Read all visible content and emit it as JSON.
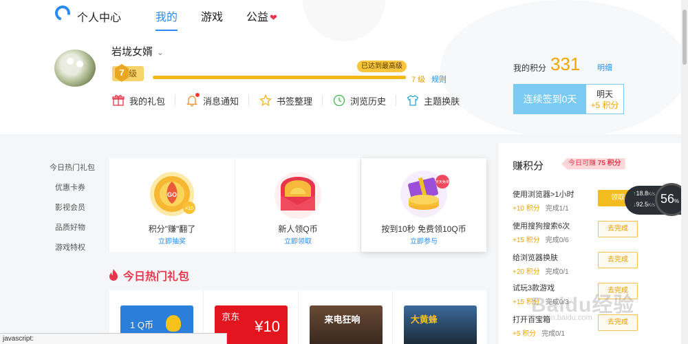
{
  "header": {
    "title": "个人中心",
    "tabs": [
      {
        "label": "我的",
        "active": true
      },
      {
        "label": "游戏",
        "active": false
      },
      {
        "label": "公益",
        "active": false,
        "icon": "heart-icon"
      }
    ]
  },
  "profile": {
    "username": "岩垅女婿",
    "level_num": "7",
    "level_label": "级",
    "max_tip": "已达到最高级",
    "level_text": "7 级",
    "rules": "规则",
    "progress": 1.0
  },
  "shortcuts": [
    {
      "label": "我的礼包",
      "icon": "gift-icon"
    },
    {
      "label": "消息通知",
      "icon": "bell-icon",
      "has_dot": true
    },
    {
      "label": "书签整理",
      "icon": "star-icon"
    },
    {
      "label": "浏览历史",
      "icon": "clock-icon"
    },
    {
      "label": "主题换肤",
      "icon": "shirt-icon"
    }
  ],
  "points": {
    "label": "我的积分",
    "value": "331",
    "detail": "明细"
  },
  "signin": {
    "button": "连续签到0天",
    "side_line1": "明天",
    "side_line2": "+5 积分"
  },
  "sidenav": [
    "今日热门礼包",
    "优惠卡券",
    "影视会员",
    "品质好物",
    "游戏特权"
  ],
  "cards": [
    {
      "title": "积分\"赚\"翻了",
      "link": "立即抽奖",
      "art_text": "GO",
      "art_badge": "×10"
    },
    {
      "title": "新人领Q币",
      "link": "立即领取"
    },
    {
      "title": "按到10秒 免费领10Q币",
      "link": "立即参与",
      "art_badge": "天天免单"
    }
  ],
  "hot": {
    "title": "今日热门礼包"
  },
  "packs": [
    {
      "text": "1 Q币"
    },
    {
      "text": "京东",
      "sub": "¥10"
    },
    {
      "text": "来电狂响"
    },
    {
      "text": "大黄蜂"
    }
  ],
  "earn": {
    "title": "赚积分",
    "badge_prefix": "今日可赚",
    "badge_value": "75 积分",
    "tasks": [
      {
        "name": "使用浏览器>1小时",
        "points": "+10 积分",
        "progress": "完成1/1",
        "button": "领取",
        "primary": true
      },
      {
        "name": "使用搜狗搜索6次",
        "points": "+15 积分",
        "progress": "完成0/6",
        "button": "去完成",
        "primary": false
      },
      {
        "name": "给浏览器换肤",
        "points": "+20 积分",
        "progress": "完成0/1",
        "button": "去完成",
        "primary": false
      },
      {
        "name": "试玩3款游戏",
        "points": "+15 积分",
        "progress": "完成0/3",
        "button": "去完成",
        "primary": false
      },
      {
        "name": "打开百宝箱",
        "points": "+5 积分",
        "progress": "完成0/1",
        "button": "去完成",
        "primary": false
      }
    ]
  },
  "speed": {
    "up": "18.8",
    "down": "92.5",
    "unit": "K/s",
    "percent": "56",
    "percent_unit": "%"
  },
  "statusbar": "javascript:",
  "watermark": {
    "text": "Baidu经验",
    "sub": "jingyan.baidu.com"
  },
  "colors": {
    "accent": "#2a8cf0",
    "gold": "#f0a500",
    "red": "#e8364c"
  }
}
